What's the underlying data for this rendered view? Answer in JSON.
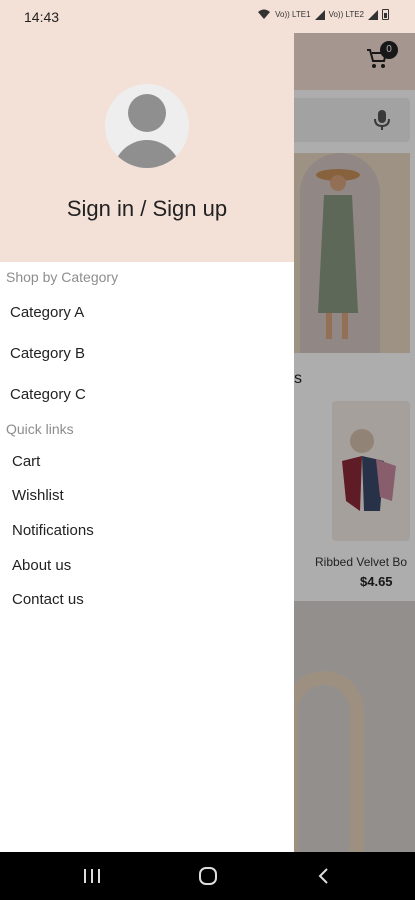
{
  "status_bar": {
    "time": "14:43",
    "signal_label_1": "Vo)) LTE1",
    "signal_label_2": "Vo)) LTE2"
  },
  "background_app": {
    "cart_count": "0",
    "section_letter": "s",
    "product": {
      "name": "Ribbed Velvet Bo",
      "price": "$4.65"
    }
  },
  "drawer": {
    "sign_in_label": "Sign in / Sign up",
    "shop_by_category": {
      "title": "Shop by Category",
      "items": [
        "Category A",
        "Category B",
        "Category C"
      ]
    },
    "quick_links": {
      "title": "Quick links",
      "items": [
        "Cart",
        "Wishlist",
        "Notifications",
        "About us",
        "Contact us"
      ]
    }
  },
  "icons": {
    "cart": "cart-icon",
    "mic": "mic-icon",
    "avatar": "avatar-icon",
    "recents": "recents-icon",
    "home": "home-icon",
    "back": "back-icon"
  },
  "colors": {
    "header_bg": "#f3e0d7",
    "nav_bar_bg": "#000000"
  }
}
